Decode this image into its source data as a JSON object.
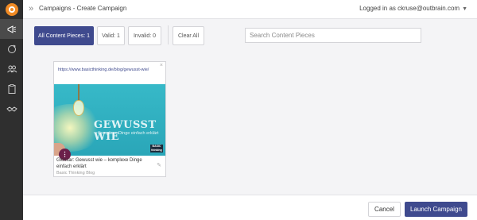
{
  "header": {
    "title": "Campaigns - Create Campaign",
    "user_text": "Logged in as ckruse@outbrain.com"
  },
  "sidebar": {
    "items": [
      {
        "icon": "megaphone-icon"
      },
      {
        "icon": "refresh-icon"
      },
      {
        "icon": "users-icon"
      },
      {
        "icon": "clipboard-icon"
      },
      {
        "icon": "handshake-icon"
      }
    ]
  },
  "filters": {
    "all": "All Content Pieces: 1",
    "valid": "Valid: 1",
    "invalid": "Invalid: 0",
    "clear": "Clear All"
  },
  "search": {
    "placeholder": "Search Content Pieces"
  },
  "content_card": {
    "url": "https://www.basicthinking.de/blog/gewusst-wie/",
    "image_headline": "GEWUSST WIE",
    "image_tagline": "Komplexe Dinge einfach erklärt",
    "image_brand": "BASIC thinking",
    "caption": "Glossar: Gewusst wie – komplexe Dinge einfach erklärt",
    "source": "Basic Thinking Blog"
  },
  "footer": {
    "cancel": "Cancel",
    "launch": "Launch Campaign"
  },
  "colors": {
    "accent": "#3f4a8e",
    "sidebar": "#2f2f2f",
    "logo": "#f08a24"
  }
}
